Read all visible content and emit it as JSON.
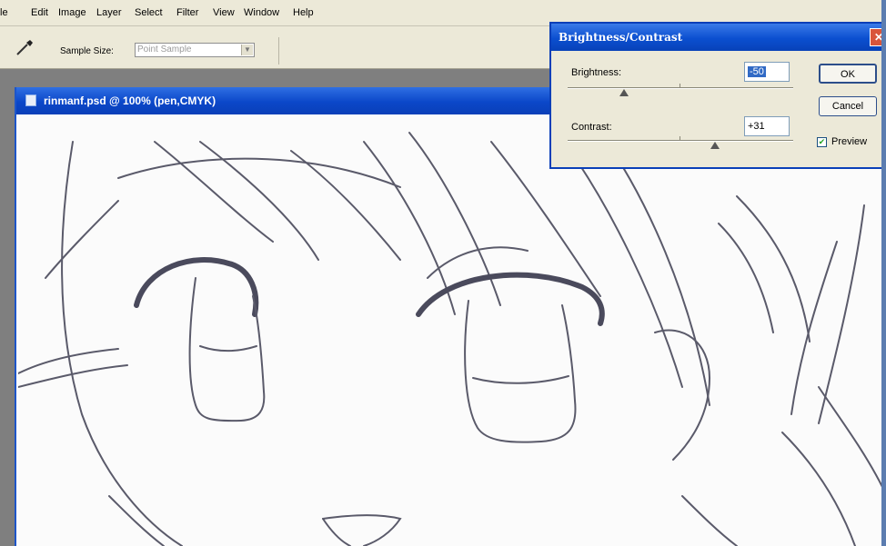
{
  "menubar": {
    "items": [
      "le",
      "Edit",
      "Image",
      "Layer",
      "Select",
      "Filter",
      "View",
      "Window",
      "Help"
    ]
  },
  "options_bar": {
    "sample_size_label": "Sample Size:",
    "sample_size_value": "Point Sample"
  },
  "document": {
    "title": "rinmanf.psd @ 100% (pen,CMYK)"
  },
  "dialog": {
    "title": "Brightness/Contrast",
    "brightness_label": "Brightness:",
    "brightness_value": "-50",
    "contrast_label": "Contrast:",
    "contrast_value": "+31",
    "ok_label": "OK",
    "cancel_label": "Cancel",
    "preview_label": "Preview",
    "preview_checked": true,
    "brightness_level": -50,
    "contrast_level": 31
  },
  "icons": {
    "tool": "eyedropper-icon",
    "close": "close-icon",
    "document": "document-icon"
  }
}
